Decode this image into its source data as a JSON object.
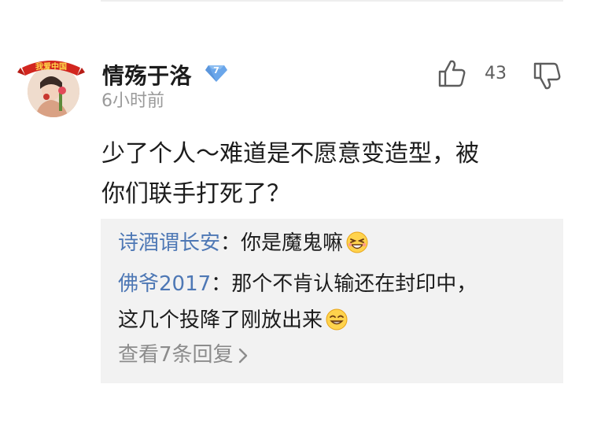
{
  "comment": {
    "author": "情殇于洛",
    "vip_level": "7",
    "time": "6小时前",
    "like_count": "43",
    "text_line1": "少了个人～难道是不愿意变造型，被",
    "text_line2": "你们联手打死了？",
    "avatar_badge_text": "我爱中国"
  },
  "replies": [
    {
      "name": "诗酒谓长安",
      "sep": "：",
      "text": "你是魔鬼嘛",
      "emoji": "laughing-face-icon"
    },
    {
      "name": "佛爷2017",
      "sep": "：",
      "text_line1": "那个不肯认输还在封印中，",
      "text_line2": "这几个投降了刚放出来",
      "emoji": "smiling-face-icon"
    }
  ],
  "view_all_replies": "查看7条回复",
  "colors": {
    "link_blue": "#4e78b5",
    "muted_gray": "#9a9a9a",
    "reply_bg": "#f2f2f2",
    "vip_badge": "#6aa6ea"
  }
}
